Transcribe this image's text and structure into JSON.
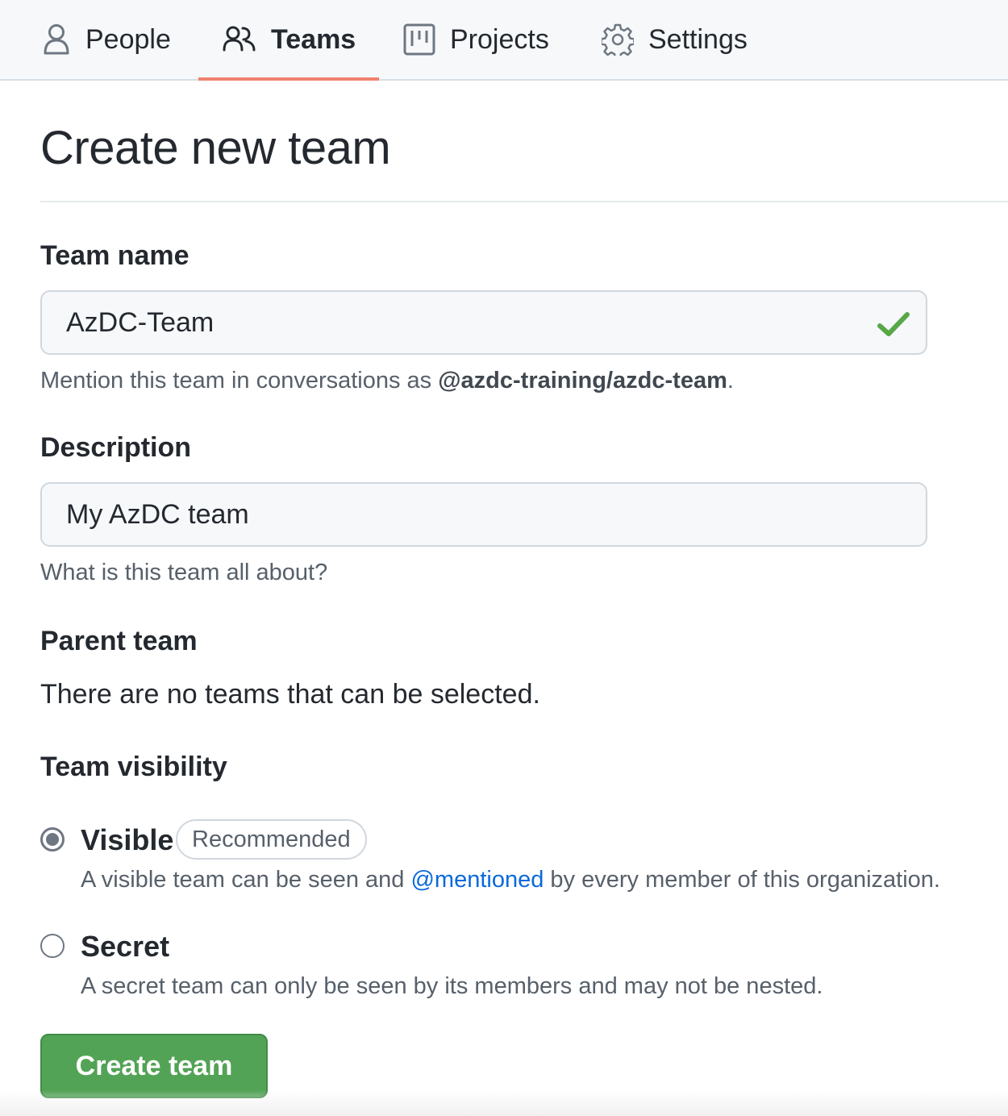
{
  "nav": {
    "tabs": [
      {
        "label": "People",
        "icon": "person-icon"
      },
      {
        "label": "Teams",
        "icon": "people-icon",
        "active": true
      },
      {
        "label": "Projects",
        "icon": "project-board-icon"
      },
      {
        "label": "Settings",
        "icon": "gear-icon"
      }
    ],
    "active_underline_color": "#f0826e"
  },
  "page": {
    "title": "Create new team"
  },
  "form": {
    "team_name": {
      "label": "Team name",
      "value": "AzDC-Team",
      "valid": true,
      "hint_prefix": "Mention this team in conversations as ",
      "hint_mention": "@azdc-training/azdc-team",
      "hint_suffix": "."
    },
    "description": {
      "label": "Description",
      "value": "My AzDC team",
      "hint": "What is this team all about?"
    },
    "parent_team": {
      "label": "Parent team",
      "text": "There are no teams that can be selected."
    },
    "visibility": {
      "label": "Team visibility",
      "selected": "visible",
      "options": [
        {
          "title": "Visible",
          "badge": "Recommended",
          "desc_prefix": "A visible team can be seen and ",
          "desc_link": "@mentioned",
          "desc_suffix": " by every member of this organization."
        },
        {
          "title": "Secret",
          "desc": "A secret team can only be seen by its members and may not be nested."
        }
      ]
    },
    "submit_label": "Create team"
  },
  "colors": {
    "primary_button": "#53a356",
    "link": "#0969da",
    "success_check": "#57a846"
  }
}
